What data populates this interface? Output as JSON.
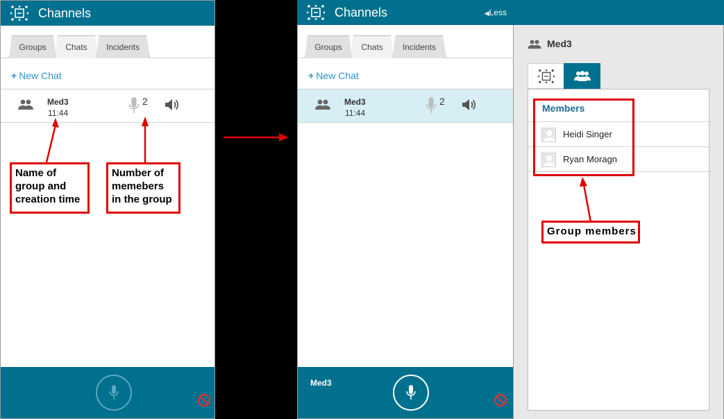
{
  "left": {
    "header_title": "Channels",
    "tabs": [
      {
        "label": "Groups"
      },
      {
        "label": "Chats"
      },
      {
        "label": "Incidents"
      }
    ],
    "new_chat_label": "New Chat",
    "chat": {
      "name": "Med3",
      "time": "11:44",
      "member_count": "2"
    }
  },
  "middle": {
    "header_title": "Channels",
    "less_label": "Less",
    "tabs": [
      {
        "label": "Groups"
      },
      {
        "label": "Chats"
      },
      {
        "label": "Incidents"
      }
    ],
    "new_chat_label": "New Chat",
    "chat": {
      "name": "Med3",
      "time": "11:44",
      "member_count": "2"
    },
    "bottom_channel_name": "Med3"
  },
  "details": {
    "title": "Med3",
    "members_heading": "Members",
    "members": [
      "Heidi Singer",
      "Ryan Moragn"
    ]
  },
  "annotations": {
    "name_time": [
      "Name of",
      "group and",
      "creation time"
    ],
    "members_count": [
      "Number of",
      "memebers",
      "in the group"
    ],
    "group_members": "Group members"
  },
  "colors": {
    "header": "#00708f",
    "accent_link": "#2f95c9",
    "annotation": "#e00000",
    "selected_row": "#d8eef5"
  },
  "icons": [
    "channels-logo-icon",
    "group-icon",
    "microphone-icon",
    "speaker-icon",
    "no-entry-icon",
    "users-icon",
    "back-arrow-icon"
  ]
}
